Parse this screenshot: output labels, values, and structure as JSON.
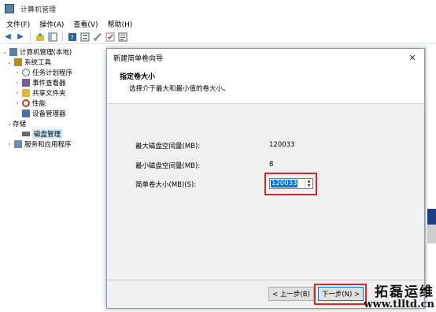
{
  "window": {
    "title": "计算机管理"
  },
  "menu": [
    "文件(F)",
    "操作(A)",
    "查看(V)",
    "帮助(H)"
  ],
  "tree": [
    {
      "label": "计算机管理(本地)",
      "expander": "⌄",
      "icon": "computer-icon",
      "icon_color": "#5a7fa6"
    },
    {
      "label": "系统工具",
      "expander": "⌄",
      "icon": "tools-icon",
      "icon_color": "#b58c2a"
    },
    {
      "label": "任务计划程序",
      "expander": "›",
      "icon": "clock-icon",
      "icon_color": "#888888"
    },
    {
      "label": "事件查看器",
      "expander": "›",
      "icon": "event-viewer-icon",
      "icon_color": "#7a5b9a"
    },
    {
      "label": "共享文件夹",
      "expander": "›",
      "icon": "shared-folder-icon",
      "icon_color": "#e3b341"
    },
    {
      "label": "性能",
      "expander": "›",
      "icon": "performance-icon",
      "icon_color": "#c0392b"
    },
    {
      "label": "设备管理器",
      "expander": "",
      "icon": "device-manager-icon",
      "icon_color": "#4a6fa5"
    },
    {
      "label": "存储",
      "expander": "⌄",
      "icon": "storage-icon",
      "icon_color": "#888888"
    },
    {
      "label": "磁盘管理",
      "expander": "",
      "icon": "disk-icon",
      "icon_color": "#666666"
    },
    {
      "label": "服务和应用程序",
      "expander": "›",
      "icon": "services-icon",
      "icon_color": "#6a8fb0"
    }
  ],
  "dialog": {
    "title": "新建简单卷向导",
    "close": "✕",
    "header": "指定卷大小",
    "subheader": "选择介于最大和最小值的卷大小。",
    "max_label": "最大磁盘空间量(MB):",
    "max_value": "120033",
    "min_label": "最小磁盘空间量(MB):",
    "min_value": "8",
    "size_label": "简单卷大小(MB)(S):",
    "size_value": "120033",
    "back_button": "< 上一步(B)",
    "next_button": "下一步(N) >"
  },
  "watermark": {
    "brand": "拓磊运维",
    "url": "www.tlltd.cn"
  },
  "colors": {
    "highlight": "#d9232d",
    "selection": "#0078d7"
  }
}
